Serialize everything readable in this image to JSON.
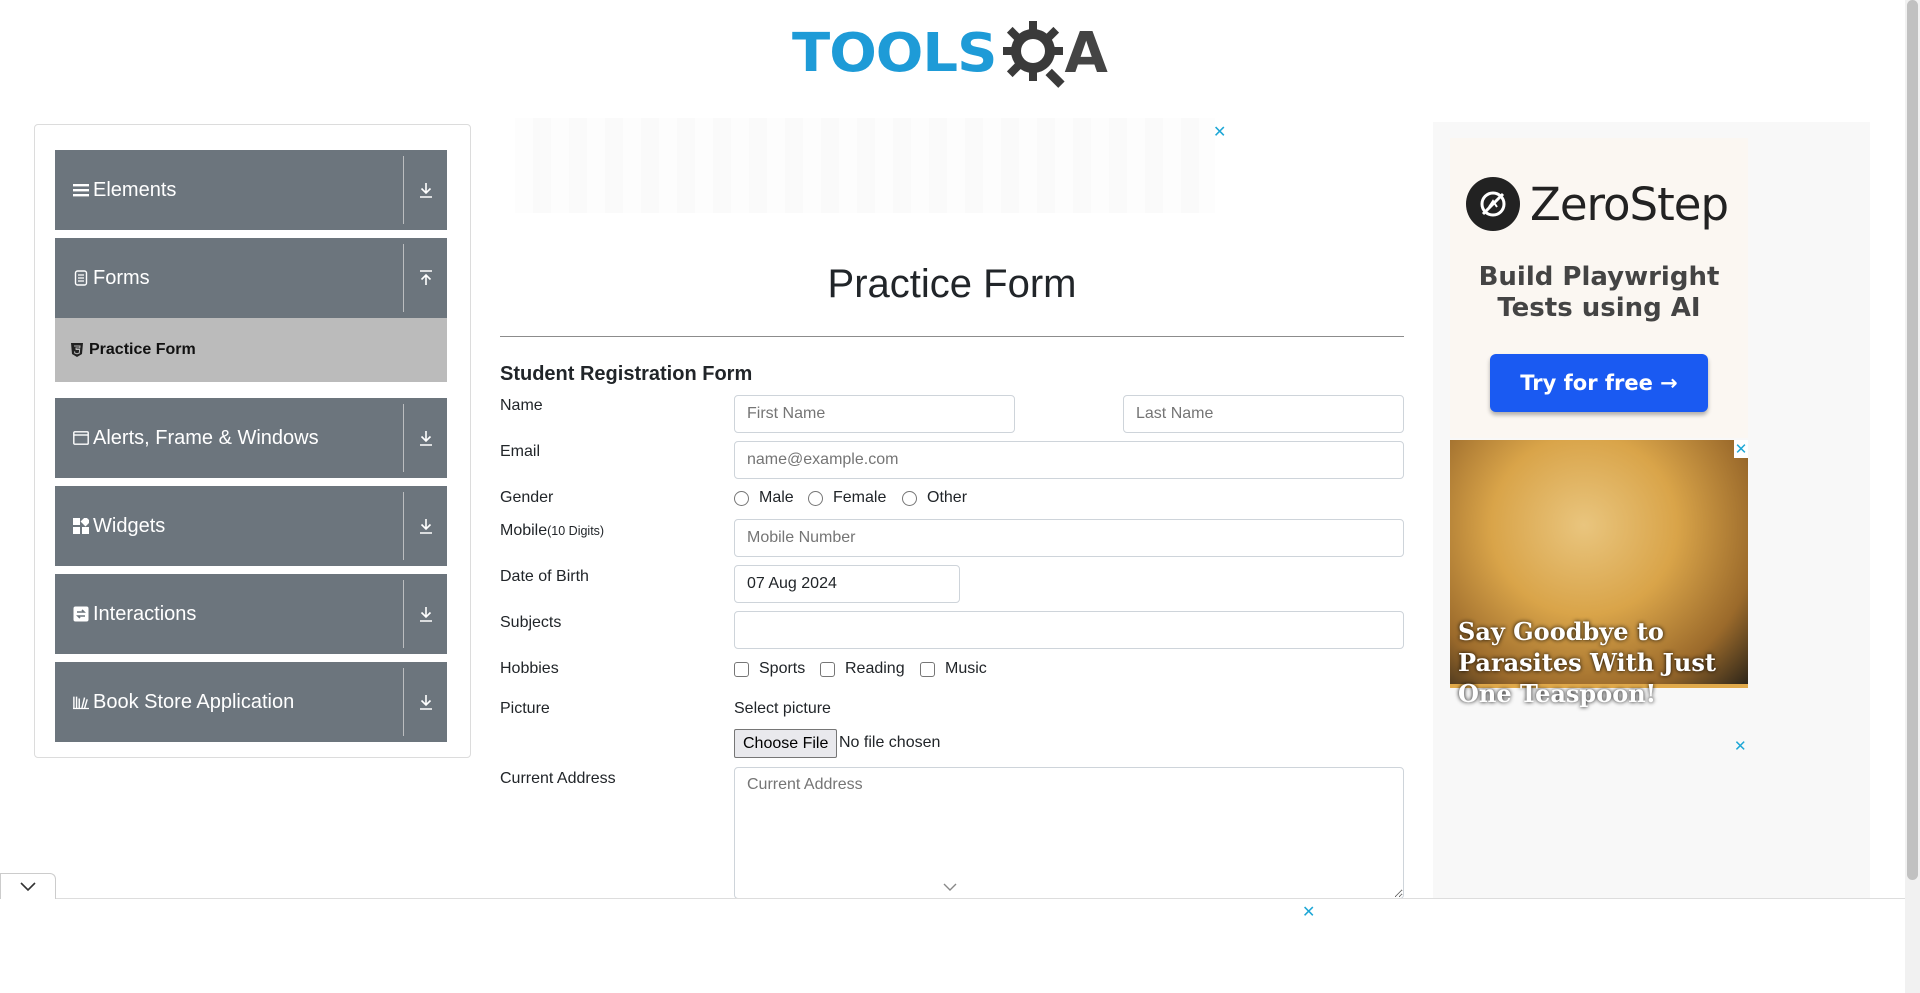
{
  "header": {
    "logo_text_tools": "TOOLS",
    "logo_text_a": "A"
  },
  "sidebar": {
    "groups": [
      {
        "label": "Elements",
        "icon": "menu-icon"
      },
      {
        "label": "Forms",
        "icon": "document-icon",
        "expanded": true
      },
      {
        "label": "Alerts, Frame & Windows",
        "icon": "window-icon"
      },
      {
        "label": "Widgets",
        "icon": "widgets-icon"
      },
      {
        "label": "Interactions",
        "icon": "interactions-icon"
      },
      {
        "label": "Book Store Application",
        "icon": "books-icon"
      }
    ],
    "sub_items": [
      {
        "label": "Practice Form",
        "icon": "html5-icon",
        "active": true
      }
    ]
  },
  "main": {
    "title": "Practice Form",
    "form_heading": "Student Registration Form",
    "labels": {
      "name": "Name",
      "email": "Email",
      "gender": "Gender",
      "mobile": "Mobile",
      "mobile_hint": "(10 Digits)",
      "dob": "Date of Birth",
      "subjects": "Subjects",
      "hobbies": "Hobbies",
      "picture": "Picture",
      "select_picture": "Select picture",
      "current_address": "Current Address"
    },
    "placeholders": {
      "first_name": "First Name",
      "last_name": "Last Name",
      "email": "name@example.com",
      "mobile": "Mobile Number",
      "current_address": "Current Address"
    },
    "values": {
      "dob": "07 Aug 2024",
      "subjects": ""
    },
    "gender_options": [
      "Male",
      "Female",
      "Other"
    ],
    "hobby_options": [
      "Sports",
      "Reading",
      "Music"
    ],
    "file": {
      "button": "Choose File",
      "status": "No file chosen"
    }
  },
  "ads": {
    "close_glyph": "✕",
    "zerostep": {
      "name": "ZeroStep",
      "tagline": "Build Playwright Tests using AI",
      "button": "Try for free →"
    },
    "parasite": {
      "headline": "Say Goodbye to Parasites With Just One Teaspoon!"
    }
  },
  "colors": {
    "sidebar_bg": "#6c757d",
    "active_item_bg": "#bbbbbb",
    "logo_blue": "#1e9bd7",
    "ad_button": "#1a5af2"
  }
}
